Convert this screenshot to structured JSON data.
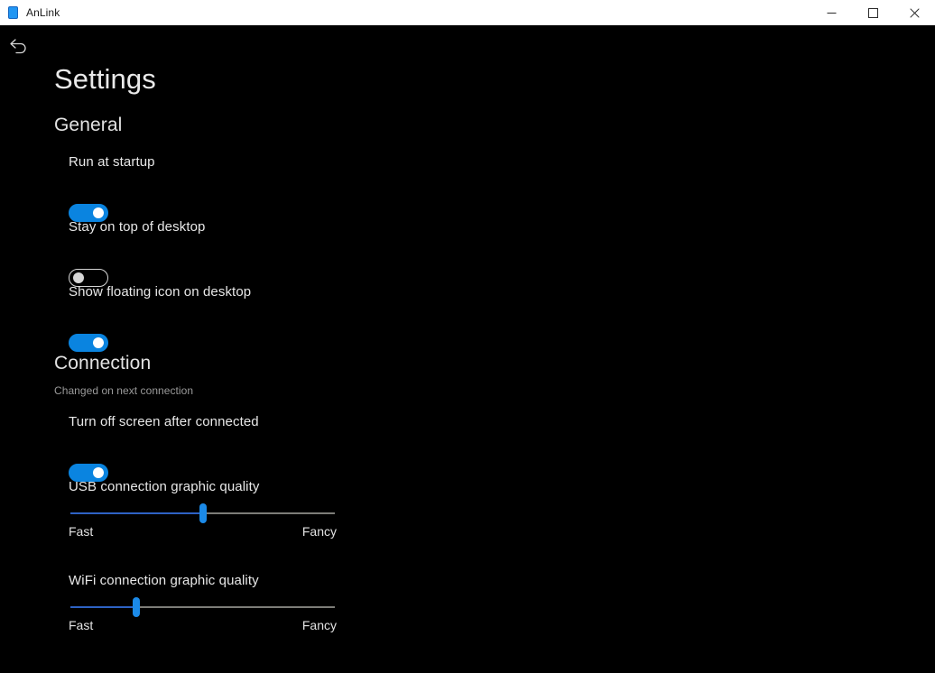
{
  "window": {
    "title": "AnLink",
    "app_icon": "phone-icon",
    "controls": {
      "minimize": "minimize-icon",
      "maximize": "maximize-icon",
      "close": "close-icon"
    }
  },
  "nav": {
    "back": "back-arrow-icon"
  },
  "page": {
    "title": "Settings"
  },
  "sections": [
    {
      "id": "general",
      "heading": "General",
      "note": "",
      "rows": [
        {
          "label": "Run at startup",
          "type": "toggle",
          "state": "on"
        },
        {
          "label": "Stay on top of desktop",
          "type": "toggle",
          "state": "off"
        },
        {
          "label": "Show floating icon on desktop",
          "type": "toggle",
          "state": "on"
        }
      ]
    },
    {
      "id": "connection",
      "heading": "Connection",
      "note": "Changed on next connection",
      "rows": [
        {
          "label": "Turn off screen after connected",
          "type": "toggle",
          "state": "on"
        },
        {
          "label": "USB connection graphic quality",
          "type": "slider",
          "value": 50,
          "min_label": "Fast",
          "max_label": "Fancy"
        },
        {
          "label": "WiFi connection graphic quality",
          "type": "slider",
          "value": 25,
          "min_label": "Fast",
          "max_label": "Fancy"
        }
      ]
    }
  ],
  "colors": {
    "accent": "#0a84e0",
    "slider_fill": "#2e62c4",
    "slider_thumb": "#1b8ae8",
    "slider_track": "#7d7d78",
    "background": "#000000",
    "titlebar": "#ffffff",
    "text": "#e8e8e8",
    "muted_text": "#9a9a9a"
  }
}
